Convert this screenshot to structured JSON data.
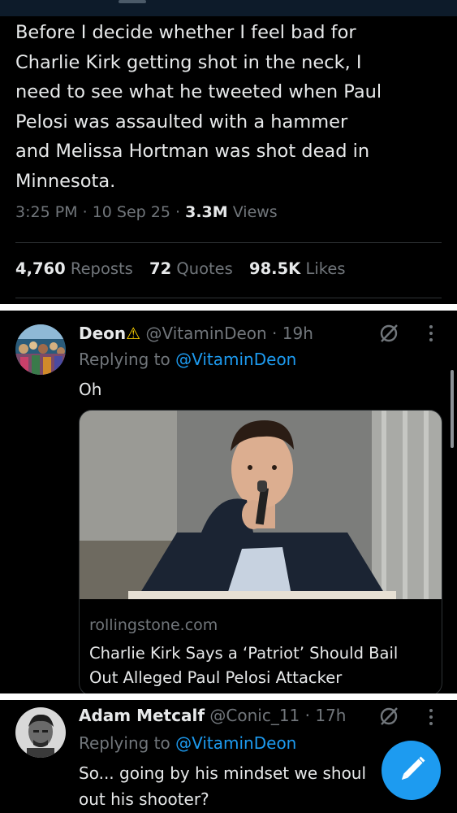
{
  "tweet": {
    "text_lines": [
      "Before I decide whether I feel bad for",
      "Charlie Kirk getting shot in the neck, I",
      "need to see what he tweeted when Paul",
      "Pelosi was assaulted with a hammer",
      "and Melissa Hortman was shot dead in",
      "Minnesota."
    ],
    "time": "3:25 PM",
    "date": "10 Sep 25",
    "views_count": "3.3M",
    "views_label": "Views",
    "reposts_count": "4,760",
    "reposts_label": "Reposts",
    "quotes_count": "72",
    "quotes_label": "Quotes",
    "likes_count": "98.5K",
    "likes_label": "Likes"
  },
  "replies": [
    {
      "name": "Deon",
      "badge": "⚠",
      "handle": "@VitaminDeon",
      "time": "19h",
      "replying_label": "Replying to",
      "replying_to": "@VitaminDeon",
      "text": "Oh",
      "card": {
        "domain": "rollingstone.com",
        "title_lines": [
          "Charlie Kirk Says a ‘Patriot’ Should Bail",
          "Out Alleged Paul Pelosi Attacker"
        ]
      }
    },
    {
      "name": "Adam Metcalf",
      "handle": "@Conic_11",
      "time": "17h",
      "replying_label": "Replying to",
      "replying_to": "@VitaminDeon",
      "text_lines": [
        "So... going by his mindset we shoul",
        "out his shooter?"
      ]
    }
  ],
  "separator": "·",
  "icons": {
    "grok": "grok-icon",
    "more": "more-icon",
    "compose": "compose-pencil-icon"
  },
  "colors": {
    "background": "#000000",
    "text": "#e7e9ea",
    "muted": "#71767b",
    "link": "#1d9bf0",
    "fab": "#1d9bf0",
    "warning": "#ffd400"
  }
}
